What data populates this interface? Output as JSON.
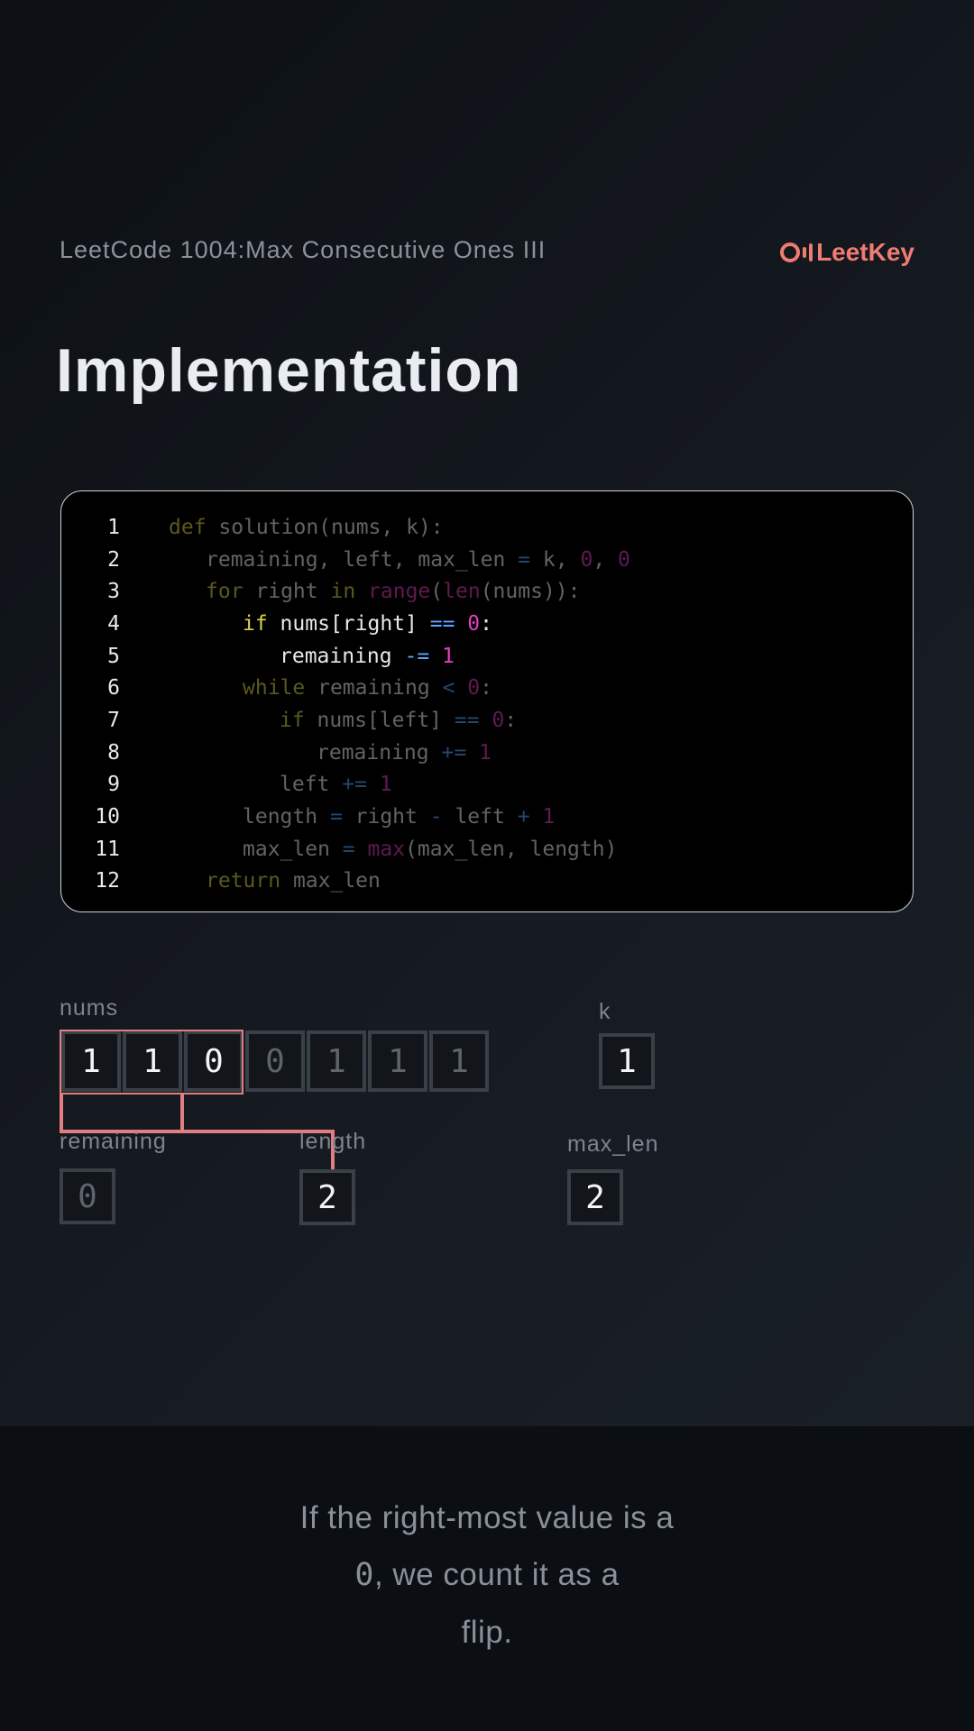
{
  "header": {
    "problem_title": "LeetCode 1004:Max Consecutive Ones III",
    "logo_text": "LeetKey",
    "accent_color": "#f07b73"
  },
  "page_title": "Implementation",
  "code": {
    "highlighted_lines": [
      4,
      5
    ],
    "lines": [
      {
        "n": "1",
        "indent": 0,
        "tokens": [
          [
            "kw",
            "def"
          ],
          [
            "tx",
            " solution(nums, k):"
          ]
        ]
      },
      {
        "n": "2",
        "indent": 1,
        "tokens": [
          [
            "tx",
            "remaining, left, max_len "
          ],
          [
            "op",
            "="
          ],
          [
            "tx",
            " k, "
          ],
          [
            "num",
            "0"
          ],
          [
            "tx",
            ", "
          ],
          [
            "num",
            "0"
          ]
        ]
      },
      {
        "n": "3",
        "indent": 1,
        "tokens": [
          [
            "kw",
            "for"
          ],
          [
            "tx",
            " right "
          ],
          [
            "kw",
            "in"
          ],
          [
            "tx",
            " "
          ],
          [
            "fn",
            "range"
          ],
          [
            "tx",
            "("
          ],
          [
            "fn",
            "len"
          ],
          [
            "tx",
            "(nums)):"
          ]
        ]
      },
      {
        "n": "4",
        "indent": 2,
        "tokens": [
          [
            "kw",
            "if"
          ],
          [
            "tx",
            " nums[right] "
          ],
          [
            "op",
            "=="
          ],
          [
            "tx",
            " "
          ],
          [
            "num",
            "0"
          ],
          [
            "tx",
            ":"
          ]
        ]
      },
      {
        "n": "5",
        "indent": 3,
        "tokens": [
          [
            "tx",
            "remaining "
          ],
          [
            "op",
            "-="
          ],
          [
            "tx",
            " "
          ],
          [
            "num",
            "1"
          ]
        ]
      },
      {
        "n": "6",
        "indent": 2,
        "tokens": [
          [
            "kw",
            "while"
          ],
          [
            "tx",
            " remaining "
          ],
          [
            "op",
            "<"
          ],
          [
            "tx",
            " "
          ],
          [
            "num",
            "0"
          ],
          [
            "tx",
            ":"
          ]
        ]
      },
      {
        "n": "7",
        "indent": 3,
        "tokens": [
          [
            "kw",
            "if"
          ],
          [
            "tx",
            " nums[left] "
          ],
          [
            "op",
            "=="
          ],
          [
            "tx",
            " "
          ],
          [
            "num",
            "0"
          ],
          [
            "tx",
            ":"
          ]
        ]
      },
      {
        "n": "8",
        "indent": 4,
        "tokens": [
          [
            "tx",
            "remaining "
          ],
          [
            "op",
            "+="
          ],
          [
            "tx",
            " "
          ],
          [
            "num",
            "1"
          ]
        ]
      },
      {
        "n": "9",
        "indent": 3,
        "tokens": [
          [
            "tx",
            "left "
          ],
          [
            "op",
            "+="
          ],
          [
            "tx",
            " "
          ],
          [
            "num",
            "1"
          ]
        ]
      },
      {
        "n": "10",
        "indent": 2,
        "tokens": [
          [
            "tx",
            "length "
          ],
          [
            "op",
            "="
          ],
          [
            "tx",
            " right "
          ],
          [
            "op",
            "-"
          ],
          [
            "tx",
            " left "
          ],
          [
            "op",
            "+"
          ],
          [
            "tx",
            " "
          ],
          [
            "num",
            "1"
          ]
        ]
      },
      {
        "n": "11",
        "indent": 2,
        "tokens": [
          [
            "tx",
            "max_len "
          ],
          [
            "op",
            "="
          ],
          [
            "tx",
            " "
          ],
          [
            "fn",
            "max"
          ],
          [
            "tx",
            "(max_len, length)"
          ]
        ]
      },
      {
        "n": "12",
        "indent": 1,
        "tokens": [
          [
            "kw",
            "return"
          ],
          [
            "tx",
            " max_len"
          ]
        ]
      }
    ]
  },
  "variables": {
    "nums": {
      "label": "nums",
      "values": [
        "1",
        "1",
        "0",
        "0",
        "1",
        "1",
        "1"
      ],
      "window_start": 0,
      "window_end": 2
    },
    "k": {
      "label": "k",
      "value": "1"
    },
    "remaining": {
      "label": "remaining",
      "value": "0"
    },
    "length": {
      "label": "length",
      "value": "2"
    },
    "max_len": {
      "label": "max_len",
      "value": "2"
    }
  },
  "caption": {
    "line1": "If the right-most value is a",
    "code_value": "0",
    "line2_rest": ", we count it as a",
    "line3": "flip."
  }
}
